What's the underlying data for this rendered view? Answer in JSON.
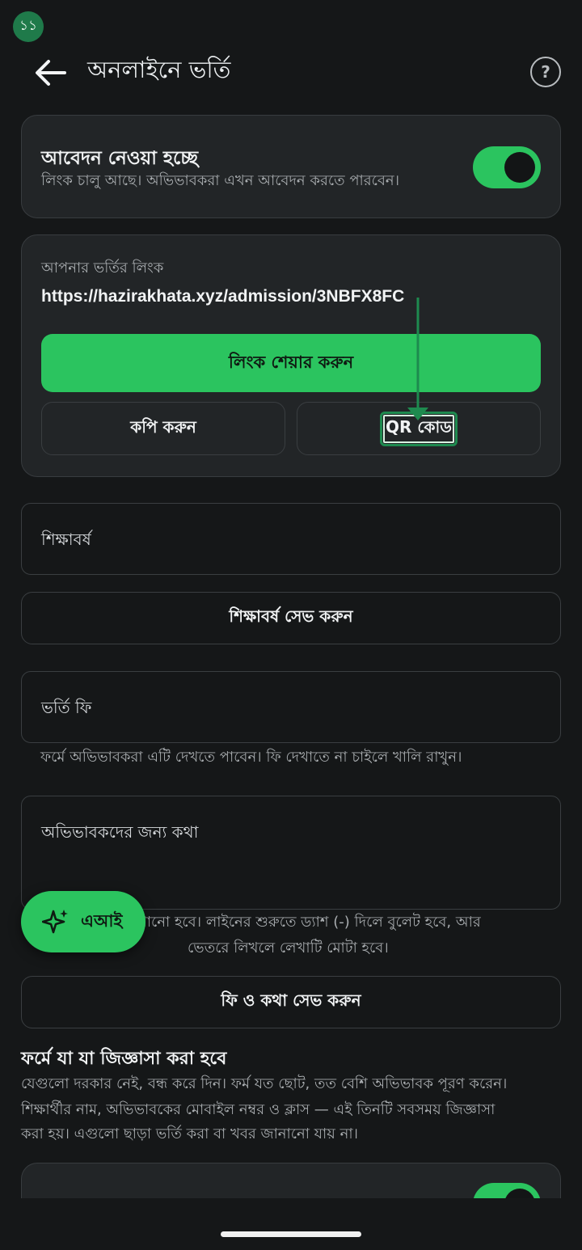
{
  "status": {
    "badge": "১১"
  },
  "header": {
    "title": "অনলাইনে ভর্তি",
    "help_icon": "?"
  },
  "accepting": {
    "title": "আবেদন নেওয়া হচ্ছে",
    "subtitle": "লিংক চালু আছে। অভিভাবকরা এখন আবেদন করতে পারবেন।",
    "enabled": true
  },
  "link_card": {
    "label": "আপনার ভর্তির লিংক",
    "url": "https://hazirakhata.xyz/admission/3NBFX8FC",
    "share_label": "লিংক শেয়ার করুন",
    "copy_label": "কপি করুন",
    "qr_label": "QR কোড"
  },
  "session_field": {
    "label": "শিক্ষাবর্ষ",
    "save_label": "শিক্ষাবর্ষ সেভ করুন"
  },
  "fee_field": {
    "label": "ভর্তি ফি",
    "helper": "ফর্মে অভিভাবকরা এটি দেখতে পাবেন। ফি দেখাতে না চাইলে খালি রাখুন।"
  },
  "note_field": {
    "label": "অভিভাবকদের জন্য কথা",
    "helper_line1": "খানো হবে। লাইনের শুরুতে ড্যাশ (-) দিলে বুলেট হবে, আর",
    "helper_line2": "ভেতরে লিখলে লেখাটি মোটা হবে।"
  },
  "save_fee_note_label": "ফি ও কথা সেভ করুন",
  "questions": {
    "heading": "ফর্মে যা যা জিজ্ঞাসা করা হবে",
    "desc_line1": "যেগুলো দরকার নেই, বন্ধ করে দিন। ফর্ম যত ছোট, তত বেশি অভিভাবক পূরণ করেন।",
    "desc_line2": "শিক্ষার্থীর নাম, অভিভাবকের মোবাইল নম্বর ও ক্লাস — এই তিনটি সবসময় জিজ্ঞাসা",
    "desc_line3": "করা হয়। এগুলো ছাড়া ভর্তি করা বা খবর জানানো যায় না।"
  },
  "fab": {
    "label": "এআই",
    "icon": "sparkle-icon"
  },
  "colors": {
    "accent": "#2bc45f",
    "background": "#151718",
    "card": "#222527",
    "annotation": "#1e8a4f"
  }
}
